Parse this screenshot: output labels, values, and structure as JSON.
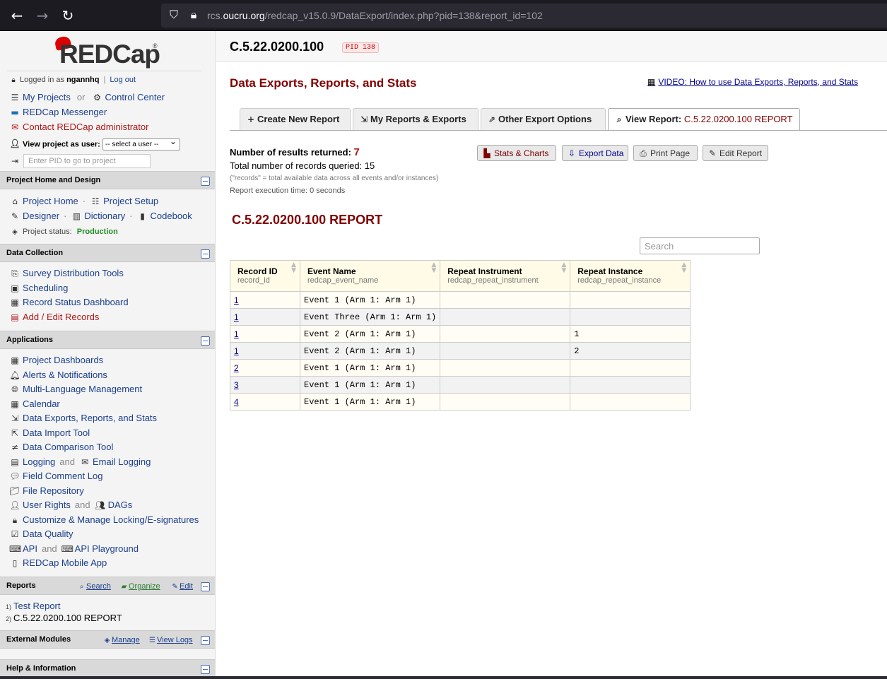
{
  "browser": {
    "url_prefix": "rcs.",
    "url_domain": "oucru.org",
    "url_path": "/redcap_v15.0.9/DataExport/index.php?pid=138&report_id=102"
  },
  "sidebar": {
    "logo_text": "REDCap",
    "logged_in_prefix": "Logged in as",
    "username": "ngannhq",
    "logout": "Log out",
    "my_projects": "My Projects",
    "or": "or",
    "control_center": "Control Center",
    "messenger": "REDCap Messenger",
    "contact_admin": "Contact REDCap administrator",
    "view_as_label": "View project as user:",
    "view_as_select": "-- select a user --",
    "pid_placeholder": "Enter PID to go to project",
    "sections": {
      "home_design": {
        "title": "Project Home and Design",
        "project_home": "Project Home",
        "project_setup": "Project Setup",
        "designer": "Designer",
        "dictionary": "Dictionary",
        "codebook": "Codebook",
        "status_label": "Project status:",
        "status_value": "Production"
      },
      "data_collection": {
        "title": "Data Collection",
        "items": [
          "Survey Distribution Tools",
          "Scheduling",
          "Record Status Dashboard",
          "Add / Edit Records"
        ]
      },
      "applications": {
        "title": "Applications",
        "project_dashboards": "Project Dashboards",
        "alerts": "Alerts & Notifications",
        "mlm": "Multi-Language Management",
        "calendar": "Calendar",
        "data_exports": "Data Exports, Reports, and Stats",
        "data_import": "Data Import Tool",
        "data_comparison": "Data Comparison Tool",
        "logging": "Logging",
        "and": "and",
        "email_logging": "Email Logging",
        "field_comment_log": "Field Comment Log",
        "file_repository": "File Repository",
        "user_rights": "User Rights",
        "dags": "DAGs",
        "locking": "Customize & Manage Locking/E-signatures",
        "data_quality": "Data Quality",
        "api": "API",
        "api_playground": "API Playground",
        "mobile_app": "REDCap Mobile App"
      },
      "reports": {
        "title": "Reports",
        "search": "Search",
        "organize": "Organize",
        "edit": "Edit",
        "items": [
          {
            "num": "1)",
            "label": "Test Report"
          },
          {
            "num": "2)",
            "label": "C.5.22.0200.100 REPORT"
          }
        ]
      },
      "external_modules": {
        "title": "External Modules",
        "manage": "Manage",
        "view_logs": "View Logs"
      },
      "help": {
        "title": "Help & Information"
      }
    }
  },
  "main": {
    "project_title": "C.5.22.0200.100",
    "pid_badge": "PID 138",
    "page_heading": "Data Exports, Reports, and Stats",
    "video_link": "VIDEO: How to use Data Exports, Reports, and Stats",
    "tabs": {
      "create": "Create New Report",
      "my_reports": "My Reports & Exports",
      "other": "Other Export Options",
      "view_label": "View Report:",
      "view_name": "C.5.22.0200.100 REPORT"
    },
    "results": {
      "label": "Number of results returned:",
      "count": "7",
      "total_label": "Total number of records queried:",
      "total": "15",
      "note": "(\"records\" = total available data across all events and/or instances)",
      "exec_time": "Report execution time: 0 seconds"
    },
    "buttons": {
      "stats": "Stats & Charts",
      "export": "Export Data",
      "print": "Print Page",
      "edit": "Edit Report"
    },
    "report_title": "C.5.22.0200.100 REPORT",
    "search_placeholder": "Search",
    "table": {
      "headers": [
        {
          "label": "Record ID",
          "var": "record_id"
        },
        {
          "label": "Event Name",
          "var": "redcap_event_name"
        },
        {
          "label": "Repeat Instrument",
          "var": "redcap_repeat_instrument"
        },
        {
          "label": "Repeat Instance",
          "var": "redcap_repeat_instance"
        }
      ],
      "rows": [
        [
          "1",
          "Event 1 (Arm 1: Arm 1)",
          "",
          ""
        ],
        [
          "1",
          "Event Three (Arm 1: Arm 1)",
          "",
          ""
        ],
        [
          "1",
          "Event 2 (Arm 1: Arm 1)",
          "",
          "1"
        ],
        [
          "1",
          "Event 2 (Arm 1: Arm 1)",
          "",
          "2"
        ],
        [
          "2",
          "Event 1 (Arm 1: Arm 1)",
          "",
          ""
        ],
        [
          "3",
          "Event 1 (Arm 1: Arm 1)",
          "",
          ""
        ],
        [
          "4",
          "Event 1 (Arm 1: Arm 1)",
          "",
          ""
        ]
      ]
    }
  }
}
